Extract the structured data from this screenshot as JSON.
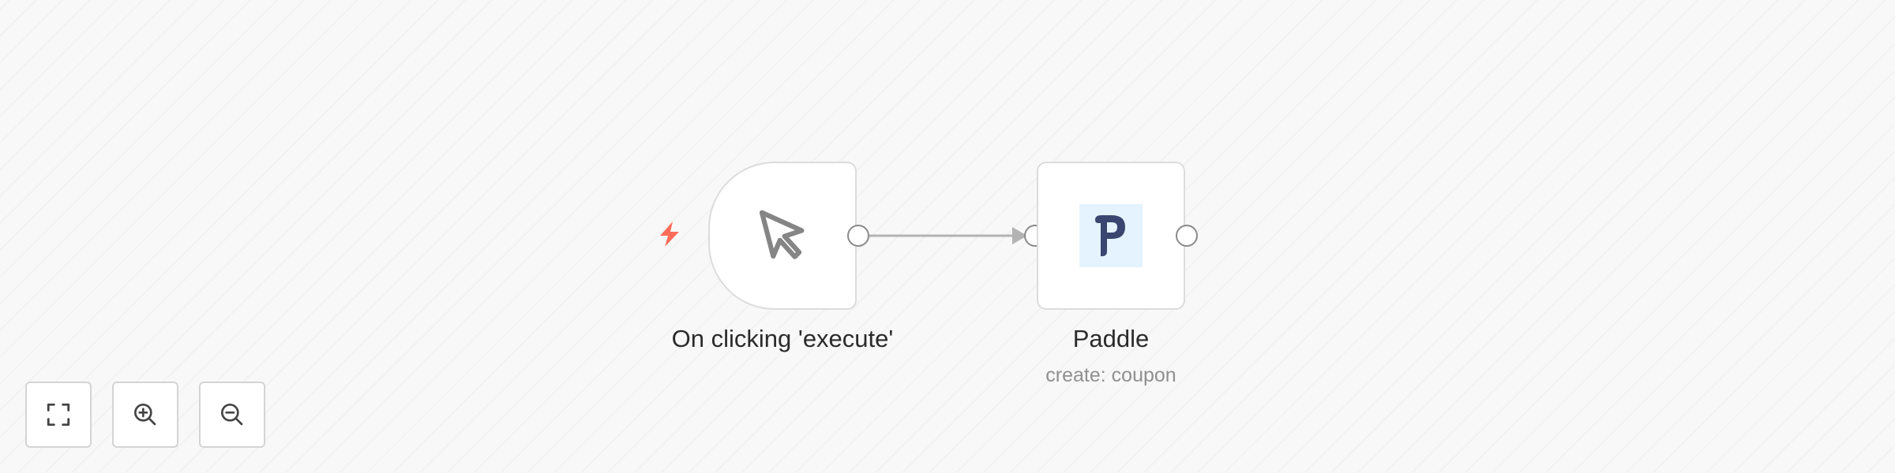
{
  "nodes": {
    "trigger": {
      "label": "On clicking 'execute'",
      "icon": "mouse-pointer-icon",
      "badge_icon": "lightning-bolt-icon"
    },
    "paddle": {
      "label": "Paddle",
      "sublabel": "create: coupon",
      "icon": "paddle-logo-icon",
      "logo_letter": "P"
    }
  },
  "toolbar": {
    "buttons": [
      {
        "name": "fit-view",
        "icon": "fullscreen-icon"
      },
      {
        "name": "zoom-in",
        "icon": "zoom-in-icon"
      },
      {
        "name": "zoom-out",
        "icon": "zoom-out-icon"
      }
    ]
  },
  "colors": {
    "canvas_bg": "#f8f8f8",
    "node_border": "#dcdcdc",
    "handle_border": "#8a8a8a",
    "connection": "#b3b3b3",
    "trigger_bolt": "#ff6d5a",
    "paddle_logo_bg": "#e4f3fd",
    "paddle_logo_fg": "#3a4670"
  }
}
